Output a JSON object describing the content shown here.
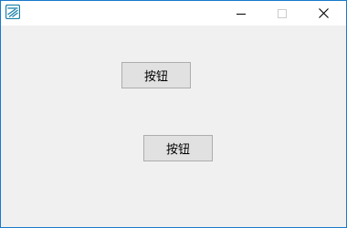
{
  "window": {
    "accent": "#1979ca",
    "icon": "app-icon",
    "controls": {
      "minimize_icon": "minimize-icon",
      "maximize_icon": "maximize-icon",
      "close_icon": "close-icon"
    }
  },
  "client": {
    "button_1_label": "按钮",
    "button_2_label": "按钮"
  }
}
